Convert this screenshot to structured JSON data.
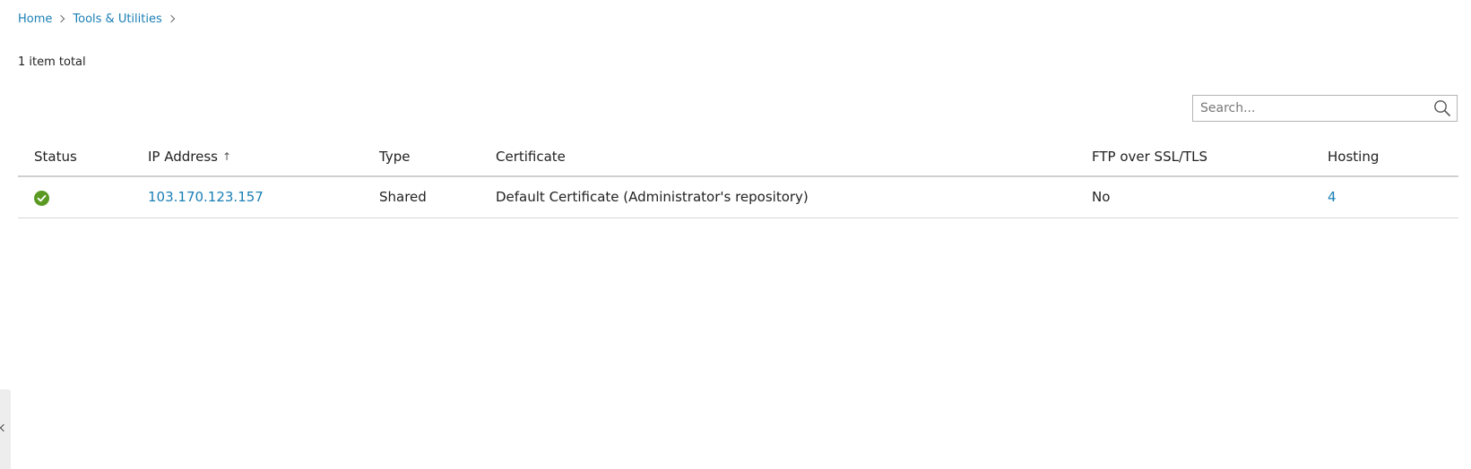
{
  "breadcrumb": {
    "items": [
      {
        "label": "Home"
      },
      {
        "label": "Tools & Utilities"
      }
    ]
  },
  "summary": {
    "item_total": "1 item total"
  },
  "search": {
    "placeholder": "Search...",
    "value": ""
  },
  "table": {
    "columns": [
      {
        "label": "Status"
      },
      {
        "label": "IP Address",
        "sort": "↑"
      },
      {
        "label": "Type"
      },
      {
        "label": "Certificate"
      },
      {
        "label": "FTP over SSL/TLS"
      },
      {
        "label": "Hosting"
      }
    ],
    "rows": [
      {
        "status": "ok",
        "ip_address": "103.170.123.157",
        "type": "Shared",
        "certificate": "Default Certificate (Administrator's repository)",
        "ftp_over_ssl_tls": "No",
        "hosting": "4"
      }
    ]
  },
  "colors": {
    "link": "#1a7fb5",
    "status_ok": "#5a9a22"
  },
  "icons": {
    "status": "check-circle-icon",
    "search": "search-icon",
    "sidebar_toggle": "chevron-left-icon"
  }
}
